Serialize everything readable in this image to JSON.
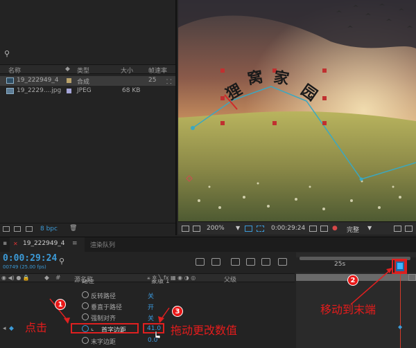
{
  "project_panel": {
    "columns": [
      "名称",
      "类型",
      "大小",
      "帧速率"
    ],
    "rows": [
      {
        "name": "19_222949_4",
        "type": "合成",
        "size": "",
        "fps": "25",
        "color": "#b9a26a",
        "kind": "comp"
      },
      {
        "name": "19_2229....jpg",
        "type": "JPEG",
        "size": "68 KB",
        "fps": "",
        "color": "#a5a5d8",
        "kind": "image"
      }
    ],
    "bpc": "8 bpc"
  },
  "viewer": {
    "art_text": [
      "狸",
      "窝",
      "家",
      "园"
    ],
    "zoom": "200%",
    "timecode": "0:00:29:24",
    "quality": "完整"
  },
  "timeline": {
    "tab_comp": "19_222949_4",
    "tab_render": "渲染队列",
    "timecode": "0:00:29:24",
    "fps_line": "00749 (25.00 fps)",
    "ruler_label": "25s",
    "col_source": "源名称",
    "col_parent": "父级",
    "rows": [
      {
        "label": "路径",
        "value": "蒙版 1",
        "value_color": "#a8a8a8"
      },
      {
        "label": "反转路径",
        "value": "关",
        "value_color": "#3b9be0"
      },
      {
        "label": "垂直于路径",
        "value": "开",
        "value_color": "#3b9be0"
      },
      {
        "label": "强制对齐",
        "value": "关",
        "value_color": "#3b9be0"
      },
      {
        "label": "首字边距",
        "value": "41.0",
        "value_color": "#3b9be0"
      },
      {
        "label": "末字边距",
        "value": "0.0",
        "value_color": "#3b9be0"
      }
    ]
  },
  "annotations": {
    "click": "点击",
    "drag": "拖动更改数值",
    "move_end": "移动到末端",
    "n1": "1",
    "n2": "2",
    "n3": "3"
  },
  "colors": {
    "accent": "#3c9bd8",
    "annotation": "#e02020"
  }
}
